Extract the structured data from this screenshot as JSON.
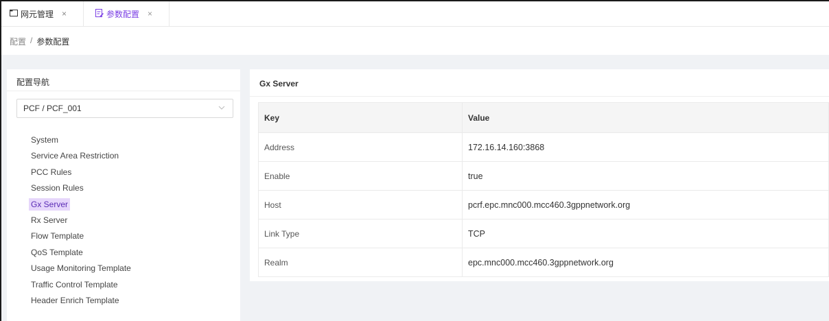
{
  "tabs": [
    {
      "label": "网元管理",
      "icon": "folder-icon",
      "active": false
    },
    {
      "label": "参数配置",
      "icon": "config-icon",
      "active": true
    }
  ],
  "tab_close_glyph": "×",
  "breadcrumb": {
    "root": "配置",
    "separator": "/",
    "current": "参数配置"
  },
  "nav": {
    "title": "配置导航",
    "selector_value": "PCF / PCF_001",
    "items": [
      "System",
      "Service Area Restriction",
      "PCC Rules",
      "Session Rules",
      "Gx Server",
      "Rx Server",
      "Flow Template",
      "QoS Template",
      "Usage Monitoring Template",
      "Traffic Control Template",
      "Header Enrich Template"
    ],
    "active_item": "Gx Server"
  },
  "main": {
    "title": "Gx Server",
    "columns": [
      "Key",
      "Value"
    ],
    "rows": [
      {
        "key": "Address",
        "value": "172.16.14.160:3868"
      },
      {
        "key": "Enable",
        "value": "true"
      },
      {
        "key": "Host",
        "value": "pcrf.epc.mnc000.mcc460.3gppnetwork.org"
      },
      {
        "key": "Link Type",
        "value": "TCP"
      },
      {
        "key": "Realm",
        "value": "epc.mnc000.mcc460.3gppnetwork.org"
      }
    ]
  },
  "colors": {
    "accent": "#7b3fe4",
    "active_highlight": "#e6d6fb"
  }
}
